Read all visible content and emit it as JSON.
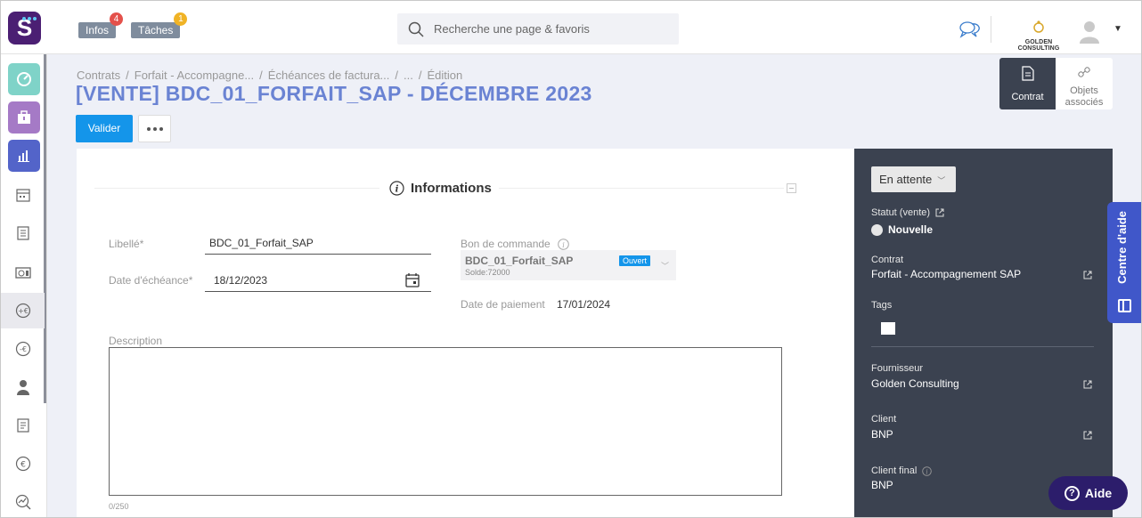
{
  "topbar": {
    "logo_letter": "S",
    "infos_label": "Infos",
    "infos_count": "4",
    "taches_label": "Tâches",
    "taches_count": "1",
    "search_placeholder": "Recherche une page & favoris",
    "company_name": "GOLDEN CONSULTING",
    "colors": {
      "infos_badge": "#e4514b",
      "taches_badge": "#f0b325"
    }
  },
  "sidebar": {
    "items": [
      {
        "icon": "dashboard-icon",
        "color": "#7fd3c8"
      },
      {
        "icon": "briefcase-icon",
        "color": "#a57ac6"
      },
      {
        "icon": "bar-chart-icon",
        "color": "#5364c9"
      },
      {
        "icon": "calendar-icon"
      },
      {
        "icon": "document-list-icon"
      },
      {
        "icon": "timesheet-icon"
      },
      {
        "icon": "revenue-icon",
        "active": true
      },
      {
        "icon": "expense-icon"
      },
      {
        "icon": "user-icon"
      },
      {
        "icon": "invoice-icon"
      },
      {
        "icon": "euro-icon"
      },
      {
        "icon": "analytics-icon"
      }
    ]
  },
  "breadcrumb": {
    "items": [
      "Contrats",
      "Forfait - Accompagne...",
      "Échéances de factura...",
      "...",
      "Édition"
    ],
    "separator": "/"
  },
  "page": {
    "title": "[VENTE] BDC_01_FORFAIT_SAP - DÉCEMBRE 2023",
    "valider_label": "Valider"
  },
  "view_tabs": {
    "contrat_label": "Contrat",
    "objets_line1": "Objets",
    "objets_line2": "associés"
  },
  "form": {
    "section_title": "Informations",
    "libelle_label": "Libellé*",
    "libelle_value": "BDC_01_Forfait_SAP",
    "date_echeance_label": "Date d'échéance*",
    "date_echeance_value": "18/12/2023",
    "bon_commande_label": "Bon de commande",
    "bon_commande_name": "BDC_01_Forfait_SAP",
    "bon_commande_solde": "Solde:72000",
    "bon_commande_status": "Ouvert",
    "date_paiement_label": "Date de paiement",
    "date_paiement_value": "17/01/2024",
    "description_label": "Description",
    "description_counter": "0/250"
  },
  "panel": {
    "status_value": "En attente",
    "statut_vente_label": "Statut (vente)",
    "statut_vente_value": "Nouvelle",
    "contrat_label": "Contrat",
    "contrat_value": "Forfait - Accompagnement SAP",
    "tags_label": "Tags",
    "fournisseur_label": "Fournisseur",
    "fournisseur_value": "Golden Consulting",
    "client_label": "Client",
    "client_value": "BNP",
    "client_final_label": "Client final",
    "client_final_value": "BNP"
  },
  "help": {
    "tab_label": "Centre d'aide",
    "aide_label": "Aide"
  }
}
